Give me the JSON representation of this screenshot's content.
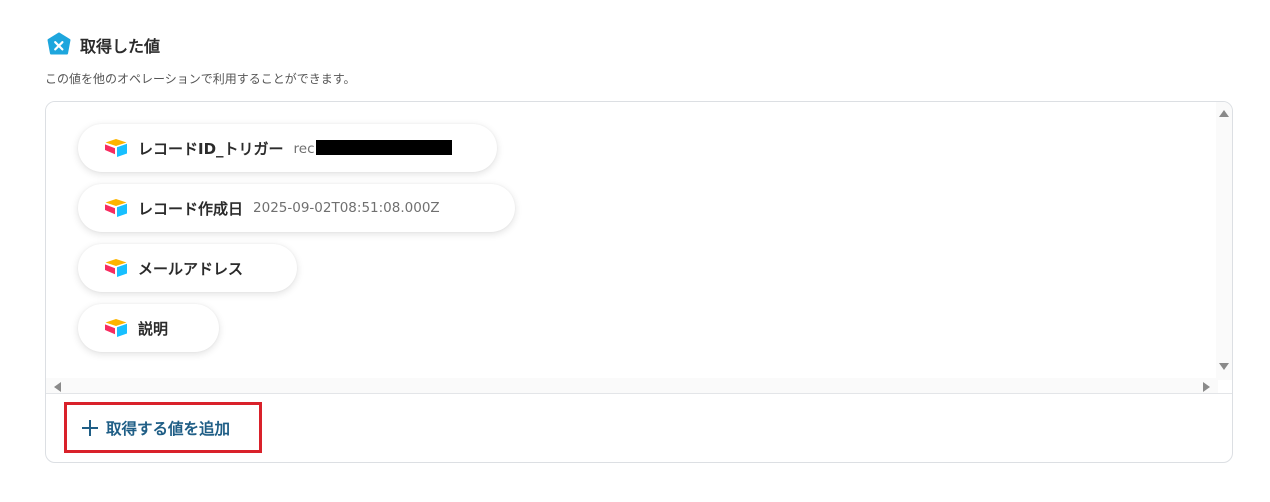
{
  "section": {
    "title": "取得した値",
    "description": "この値を他のオペレーションで利用することができます。",
    "icon": "variable-x-icon"
  },
  "values": [
    {
      "label": "レコードID_トリガー",
      "value": "rec",
      "redacted": true,
      "icon": "airtable-icon"
    },
    {
      "label": "レコード作成日",
      "value": "2025-09-02T08:51:08.000Z",
      "icon": "airtable-icon"
    },
    {
      "label": "メールアドレス",
      "value": "",
      "icon": "airtable-icon"
    },
    {
      "label": "説明",
      "value": "",
      "icon": "airtable-icon"
    }
  ],
  "add_button": {
    "label": "取得する値を追加",
    "icon": "plus-icon"
  },
  "colors": {
    "accent": "#1f5e86",
    "header_icon": "#1ea6dd",
    "highlight_border": "#d9212a",
    "airtable_yellow": "#fcb400",
    "airtable_blue": "#18bfff",
    "airtable_red": "#f82b60"
  }
}
